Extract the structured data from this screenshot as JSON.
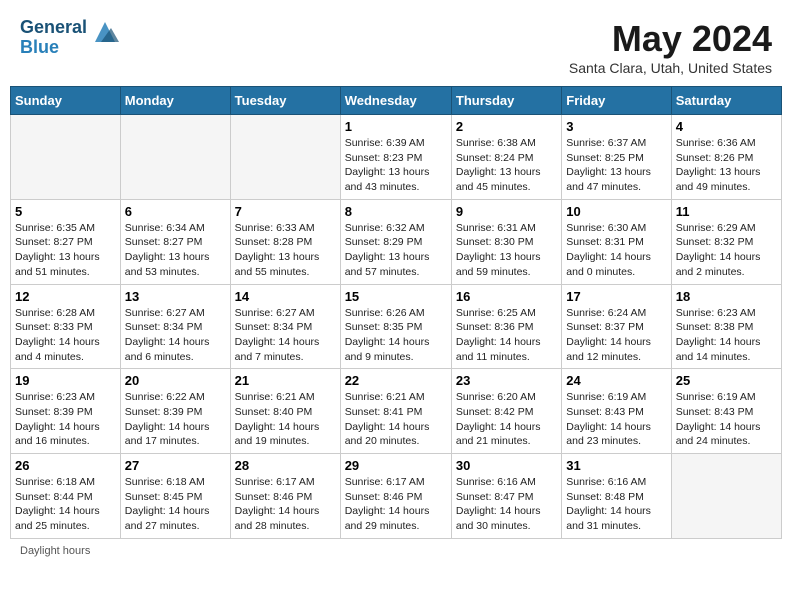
{
  "header": {
    "logo_line1": "General",
    "logo_line2": "Blue",
    "month_title": "May 2024",
    "location": "Santa Clara, Utah, United States"
  },
  "days_of_week": [
    "Sunday",
    "Monday",
    "Tuesday",
    "Wednesday",
    "Thursday",
    "Friday",
    "Saturday"
  ],
  "weeks": [
    [
      {
        "day": "",
        "info": ""
      },
      {
        "day": "",
        "info": ""
      },
      {
        "day": "",
        "info": ""
      },
      {
        "day": "1",
        "info": "Sunrise: 6:39 AM\nSunset: 8:23 PM\nDaylight: 13 hours\nand 43 minutes."
      },
      {
        "day": "2",
        "info": "Sunrise: 6:38 AM\nSunset: 8:24 PM\nDaylight: 13 hours\nand 45 minutes."
      },
      {
        "day": "3",
        "info": "Sunrise: 6:37 AM\nSunset: 8:25 PM\nDaylight: 13 hours\nand 47 minutes."
      },
      {
        "day": "4",
        "info": "Sunrise: 6:36 AM\nSunset: 8:26 PM\nDaylight: 13 hours\nand 49 minutes."
      }
    ],
    [
      {
        "day": "5",
        "info": "Sunrise: 6:35 AM\nSunset: 8:27 PM\nDaylight: 13 hours\nand 51 minutes."
      },
      {
        "day": "6",
        "info": "Sunrise: 6:34 AM\nSunset: 8:27 PM\nDaylight: 13 hours\nand 53 minutes."
      },
      {
        "day": "7",
        "info": "Sunrise: 6:33 AM\nSunset: 8:28 PM\nDaylight: 13 hours\nand 55 minutes."
      },
      {
        "day": "8",
        "info": "Sunrise: 6:32 AM\nSunset: 8:29 PM\nDaylight: 13 hours\nand 57 minutes."
      },
      {
        "day": "9",
        "info": "Sunrise: 6:31 AM\nSunset: 8:30 PM\nDaylight: 13 hours\nand 59 minutes."
      },
      {
        "day": "10",
        "info": "Sunrise: 6:30 AM\nSunset: 8:31 PM\nDaylight: 14 hours\nand 0 minutes."
      },
      {
        "day": "11",
        "info": "Sunrise: 6:29 AM\nSunset: 8:32 PM\nDaylight: 14 hours\nand 2 minutes."
      }
    ],
    [
      {
        "day": "12",
        "info": "Sunrise: 6:28 AM\nSunset: 8:33 PM\nDaylight: 14 hours\nand 4 minutes."
      },
      {
        "day": "13",
        "info": "Sunrise: 6:27 AM\nSunset: 8:34 PM\nDaylight: 14 hours\nand 6 minutes."
      },
      {
        "day": "14",
        "info": "Sunrise: 6:27 AM\nSunset: 8:34 PM\nDaylight: 14 hours\nand 7 minutes."
      },
      {
        "day": "15",
        "info": "Sunrise: 6:26 AM\nSunset: 8:35 PM\nDaylight: 14 hours\nand 9 minutes."
      },
      {
        "day": "16",
        "info": "Sunrise: 6:25 AM\nSunset: 8:36 PM\nDaylight: 14 hours\nand 11 minutes."
      },
      {
        "day": "17",
        "info": "Sunrise: 6:24 AM\nSunset: 8:37 PM\nDaylight: 14 hours\nand 12 minutes."
      },
      {
        "day": "18",
        "info": "Sunrise: 6:23 AM\nSunset: 8:38 PM\nDaylight: 14 hours\nand 14 minutes."
      }
    ],
    [
      {
        "day": "19",
        "info": "Sunrise: 6:23 AM\nSunset: 8:39 PM\nDaylight: 14 hours\nand 16 minutes."
      },
      {
        "day": "20",
        "info": "Sunrise: 6:22 AM\nSunset: 8:39 PM\nDaylight: 14 hours\nand 17 minutes."
      },
      {
        "day": "21",
        "info": "Sunrise: 6:21 AM\nSunset: 8:40 PM\nDaylight: 14 hours\nand 19 minutes."
      },
      {
        "day": "22",
        "info": "Sunrise: 6:21 AM\nSunset: 8:41 PM\nDaylight: 14 hours\nand 20 minutes."
      },
      {
        "day": "23",
        "info": "Sunrise: 6:20 AM\nSunset: 8:42 PM\nDaylight: 14 hours\nand 21 minutes."
      },
      {
        "day": "24",
        "info": "Sunrise: 6:19 AM\nSunset: 8:43 PM\nDaylight: 14 hours\nand 23 minutes."
      },
      {
        "day": "25",
        "info": "Sunrise: 6:19 AM\nSunset: 8:43 PM\nDaylight: 14 hours\nand 24 minutes."
      }
    ],
    [
      {
        "day": "26",
        "info": "Sunrise: 6:18 AM\nSunset: 8:44 PM\nDaylight: 14 hours\nand 25 minutes."
      },
      {
        "day": "27",
        "info": "Sunrise: 6:18 AM\nSunset: 8:45 PM\nDaylight: 14 hours\nand 27 minutes."
      },
      {
        "day": "28",
        "info": "Sunrise: 6:17 AM\nSunset: 8:46 PM\nDaylight: 14 hours\nand 28 minutes."
      },
      {
        "day": "29",
        "info": "Sunrise: 6:17 AM\nSunset: 8:46 PM\nDaylight: 14 hours\nand 29 minutes."
      },
      {
        "day": "30",
        "info": "Sunrise: 6:16 AM\nSunset: 8:47 PM\nDaylight: 14 hours\nand 30 minutes."
      },
      {
        "day": "31",
        "info": "Sunrise: 6:16 AM\nSunset: 8:48 PM\nDaylight: 14 hours\nand 31 minutes."
      },
      {
        "day": "",
        "info": ""
      }
    ]
  ],
  "footer": {
    "daylight_label": "Daylight hours"
  }
}
